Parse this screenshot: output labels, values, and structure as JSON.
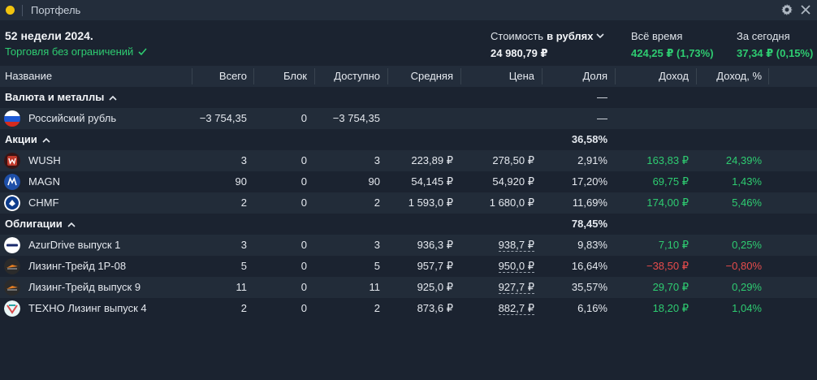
{
  "window": {
    "title": "Портфель"
  },
  "summary": {
    "period": "52 недели 2024.",
    "trade_status": "Торговля без ограничений",
    "cost_label_prefix": "Стоимость",
    "cost_label_currency": "в рублях",
    "cost_value": "24 980,79 ₽",
    "all_time_label": "Всё время",
    "all_time_value": "424,25 ₽ (1,73%)",
    "today_label": "За сегодня",
    "today_value": "37,34 ₽ (0,15%)"
  },
  "columns": {
    "name": "Название",
    "total": "Всего",
    "block": "Блок",
    "available": "Доступно",
    "avg": "Средняя",
    "price": "Цена",
    "share": "Доля",
    "income": "Доход",
    "income_pct": "Доход, %"
  },
  "groups": {
    "currency": {
      "label": "Валюта и металлы",
      "share": "—"
    },
    "stocks": {
      "label": "Акции",
      "share": "36,58%"
    },
    "bonds": {
      "label": "Облигации",
      "share": "78,45%"
    }
  },
  "rows": {
    "rub": {
      "name": "Российский рубль",
      "total": "−3 754,35",
      "block": "0",
      "available": "−3 754,35",
      "share": "—"
    },
    "wush": {
      "name": "WUSH",
      "total": "3",
      "block": "0",
      "available": "3",
      "avg": "223,89 ₽",
      "price": "278,50 ₽",
      "share": "2,91%",
      "income": "163,83 ₽",
      "income_pct": "24,39%"
    },
    "magn": {
      "name": "MAGN",
      "total": "90",
      "block": "0",
      "available": "90",
      "avg": "54,145 ₽",
      "price": "54,920 ₽",
      "share": "17,20%",
      "income": "69,75 ₽",
      "income_pct": "1,43%"
    },
    "chmf": {
      "name": "CHMF",
      "total": "2",
      "block": "0",
      "available": "2",
      "avg": "1 593,0 ₽",
      "price": "1 680,0 ₽",
      "share": "11,69%",
      "income": "174,00 ₽",
      "income_pct": "5,46%"
    },
    "azur": {
      "name": "AzurDrive выпуск 1",
      "total": "3",
      "block": "0",
      "available": "3",
      "avg": "936,3 ₽",
      "price": "938,7 ₽",
      "share": "9,83%",
      "income": "7,10 ₽",
      "income_pct": "0,25%"
    },
    "leas1": {
      "name": "Лизинг-Трейд 1Р-08",
      "total": "5",
      "block": "0",
      "available": "5",
      "avg": "957,7 ₽",
      "price": "950,0 ₽",
      "share": "16,64%",
      "income": "−38,50 ₽",
      "income_pct": "−0,80%"
    },
    "leas9": {
      "name": "Лизинг-Трейд выпуск 9",
      "total": "11",
      "block": "0",
      "available": "11",
      "avg": "925,0 ₽",
      "price": "927,7 ₽",
      "share": "35,57%",
      "income": "29,70 ₽",
      "income_pct": "0,29%"
    },
    "techno": {
      "name": "ТЕХНО Лизинг выпуск 4",
      "total": "2",
      "block": "0",
      "available": "2",
      "avg": "873,6 ₽",
      "price": "882,7 ₽",
      "share": "6,16%",
      "income": "18,20 ₽",
      "income_pct": "1,04%"
    }
  },
  "icons": {
    "window_dot": "yellow-circle",
    "settings": "gear-icon",
    "close": "close-icon",
    "collapse": "chevron-up-icon",
    "currency_toggle": "chevron-down-icon",
    "status_ok": "check-icon"
  },
  "colors": {
    "positive": "#2ecc71",
    "negative": "#e74c4c",
    "window_dot": "#f1c40f"
  }
}
